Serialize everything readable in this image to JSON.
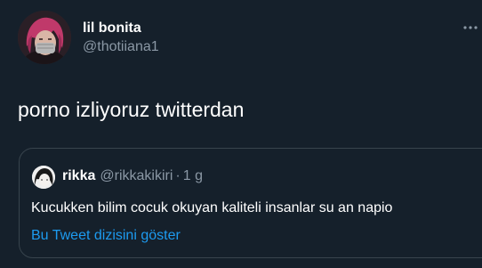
{
  "tweet": {
    "display_name": "lil bonita",
    "handle": "@thotiiana1",
    "text": "porno izliyoruz twitterdan",
    "more_icon": "more-horizontal-icon",
    "quoted": {
      "display_name": "rikka",
      "handle": "@rikkakikiri",
      "separator": "·",
      "time": "1 g",
      "text": "Kucukken bilim cocuk okuyan kaliteli insanlar su an napio",
      "thread_link": "Bu Tweet dizisini göster"
    }
  },
  "colors": {
    "background": "#15202b",
    "primary_text": "#ffffff",
    "secondary_text": "#8b98a5",
    "border": "#38444d",
    "link": "#1d9bf0"
  }
}
